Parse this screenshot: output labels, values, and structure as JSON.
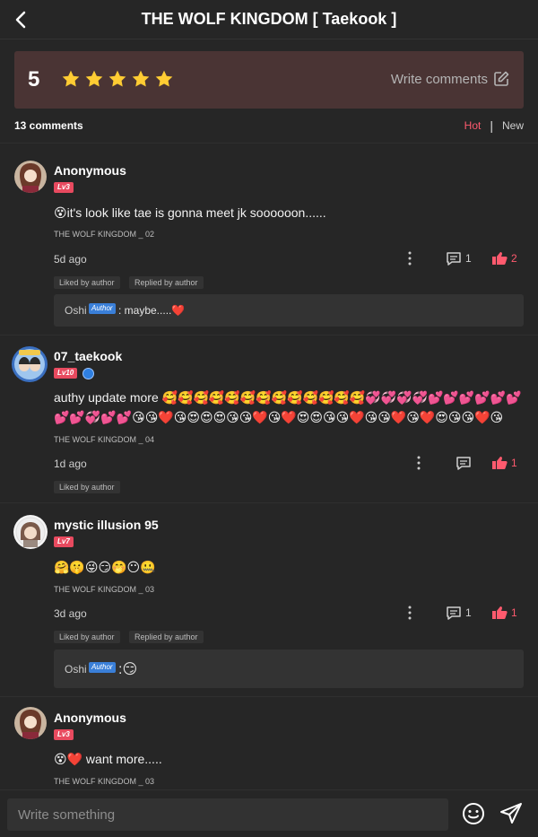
{
  "header": {
    "title": "THE WOLF KINGDOM [ Taekook ]"
  },
  "rating": {
    "score": "5",
    "stars": 5,
    "write_label": "Write comments"
  },
  "comments_header": {
    "count_label": "13 comments",
    "sort_hot": "Hot",
    "sort_separator": "|",
    "sort_new": "New"
  },
  "comments": [
    {
      "username": "Anonymous",
      "level": "Lv3",
      "text": "😵it's look like tae is gonna meet jk soooooon......",
      "chapter": "THE WOLF KINGDOM _ 02",
      "time": "5d ago",
      "replies": "1",
      "likes": "2",
      "tags": [
        "Liked by author",
        "Replied by author"
      ],
      "reply": {
        "author": "Oshi",
        "badge": "Author",
        "text": ": maybe.....❤️"
      }
    },
    {
      "username": "07_taekook",
      "level": "Lv10",
      "text": "authy update more 🥰🥰🥰🥰🥰🥰🥰🥰🥰🥰🥰🥰🥰💞💞💞💞💕💕💕💕💕💕💕💕💞💕💕😘😘❤️😘😍😍😍😘😘❤️😘❤️😍😍😘😘❤️😘😘❤️😘❤️😍😘😘❤️😘",
      "chapter": "THE WOLF KINGDOM _ 04",
      "time": "1d ago",
      "replies": "",
      "likes": "1",
      "tags": [
        "Liked by author"
      ]
    },
    {
      "username": "mystic illusion 95",
      "level": "Lv7",
      "text": "🤗🤫😜😏🤭😶🤐",
      "chapter": "THE WOLF KINGDOM _ 03",
      "time": "3d ago",
      "replies": "1",
      "likes": "1",
      "tags": [
        "Liked by author",
        "Replied by author"
      ],
      "reply": {
        "author": "Oshi",
        "badge": "Author",
        "text": ":😏"
      }
    },
    {
      "username": "Anonymous",
      "level": "Lv3",
      "text": "😵❤️ want more.....",
      "chapter": "THE WOLF KINGDOM _ 03"
    }
  ],
  "composer": {
    "placeholder": "Write something"
  },
  "colors": {
    "accent": "#ff5a6e",
    "star": "#ffcc33",
    "rating_bg": "#4a3434",
    "background": "#262626"
  },
  "icons": {
    "back": "chevron-left-icon",
    "star": "star-icon",
    "edit": "edit-icon",
    "reply": "comment-icon",
    "like": "thumbs-up-icon",
    "more": "more-vertical-icon",
    "emoji": "smiley-icon",
    "send": "send-icon"
  }
}
